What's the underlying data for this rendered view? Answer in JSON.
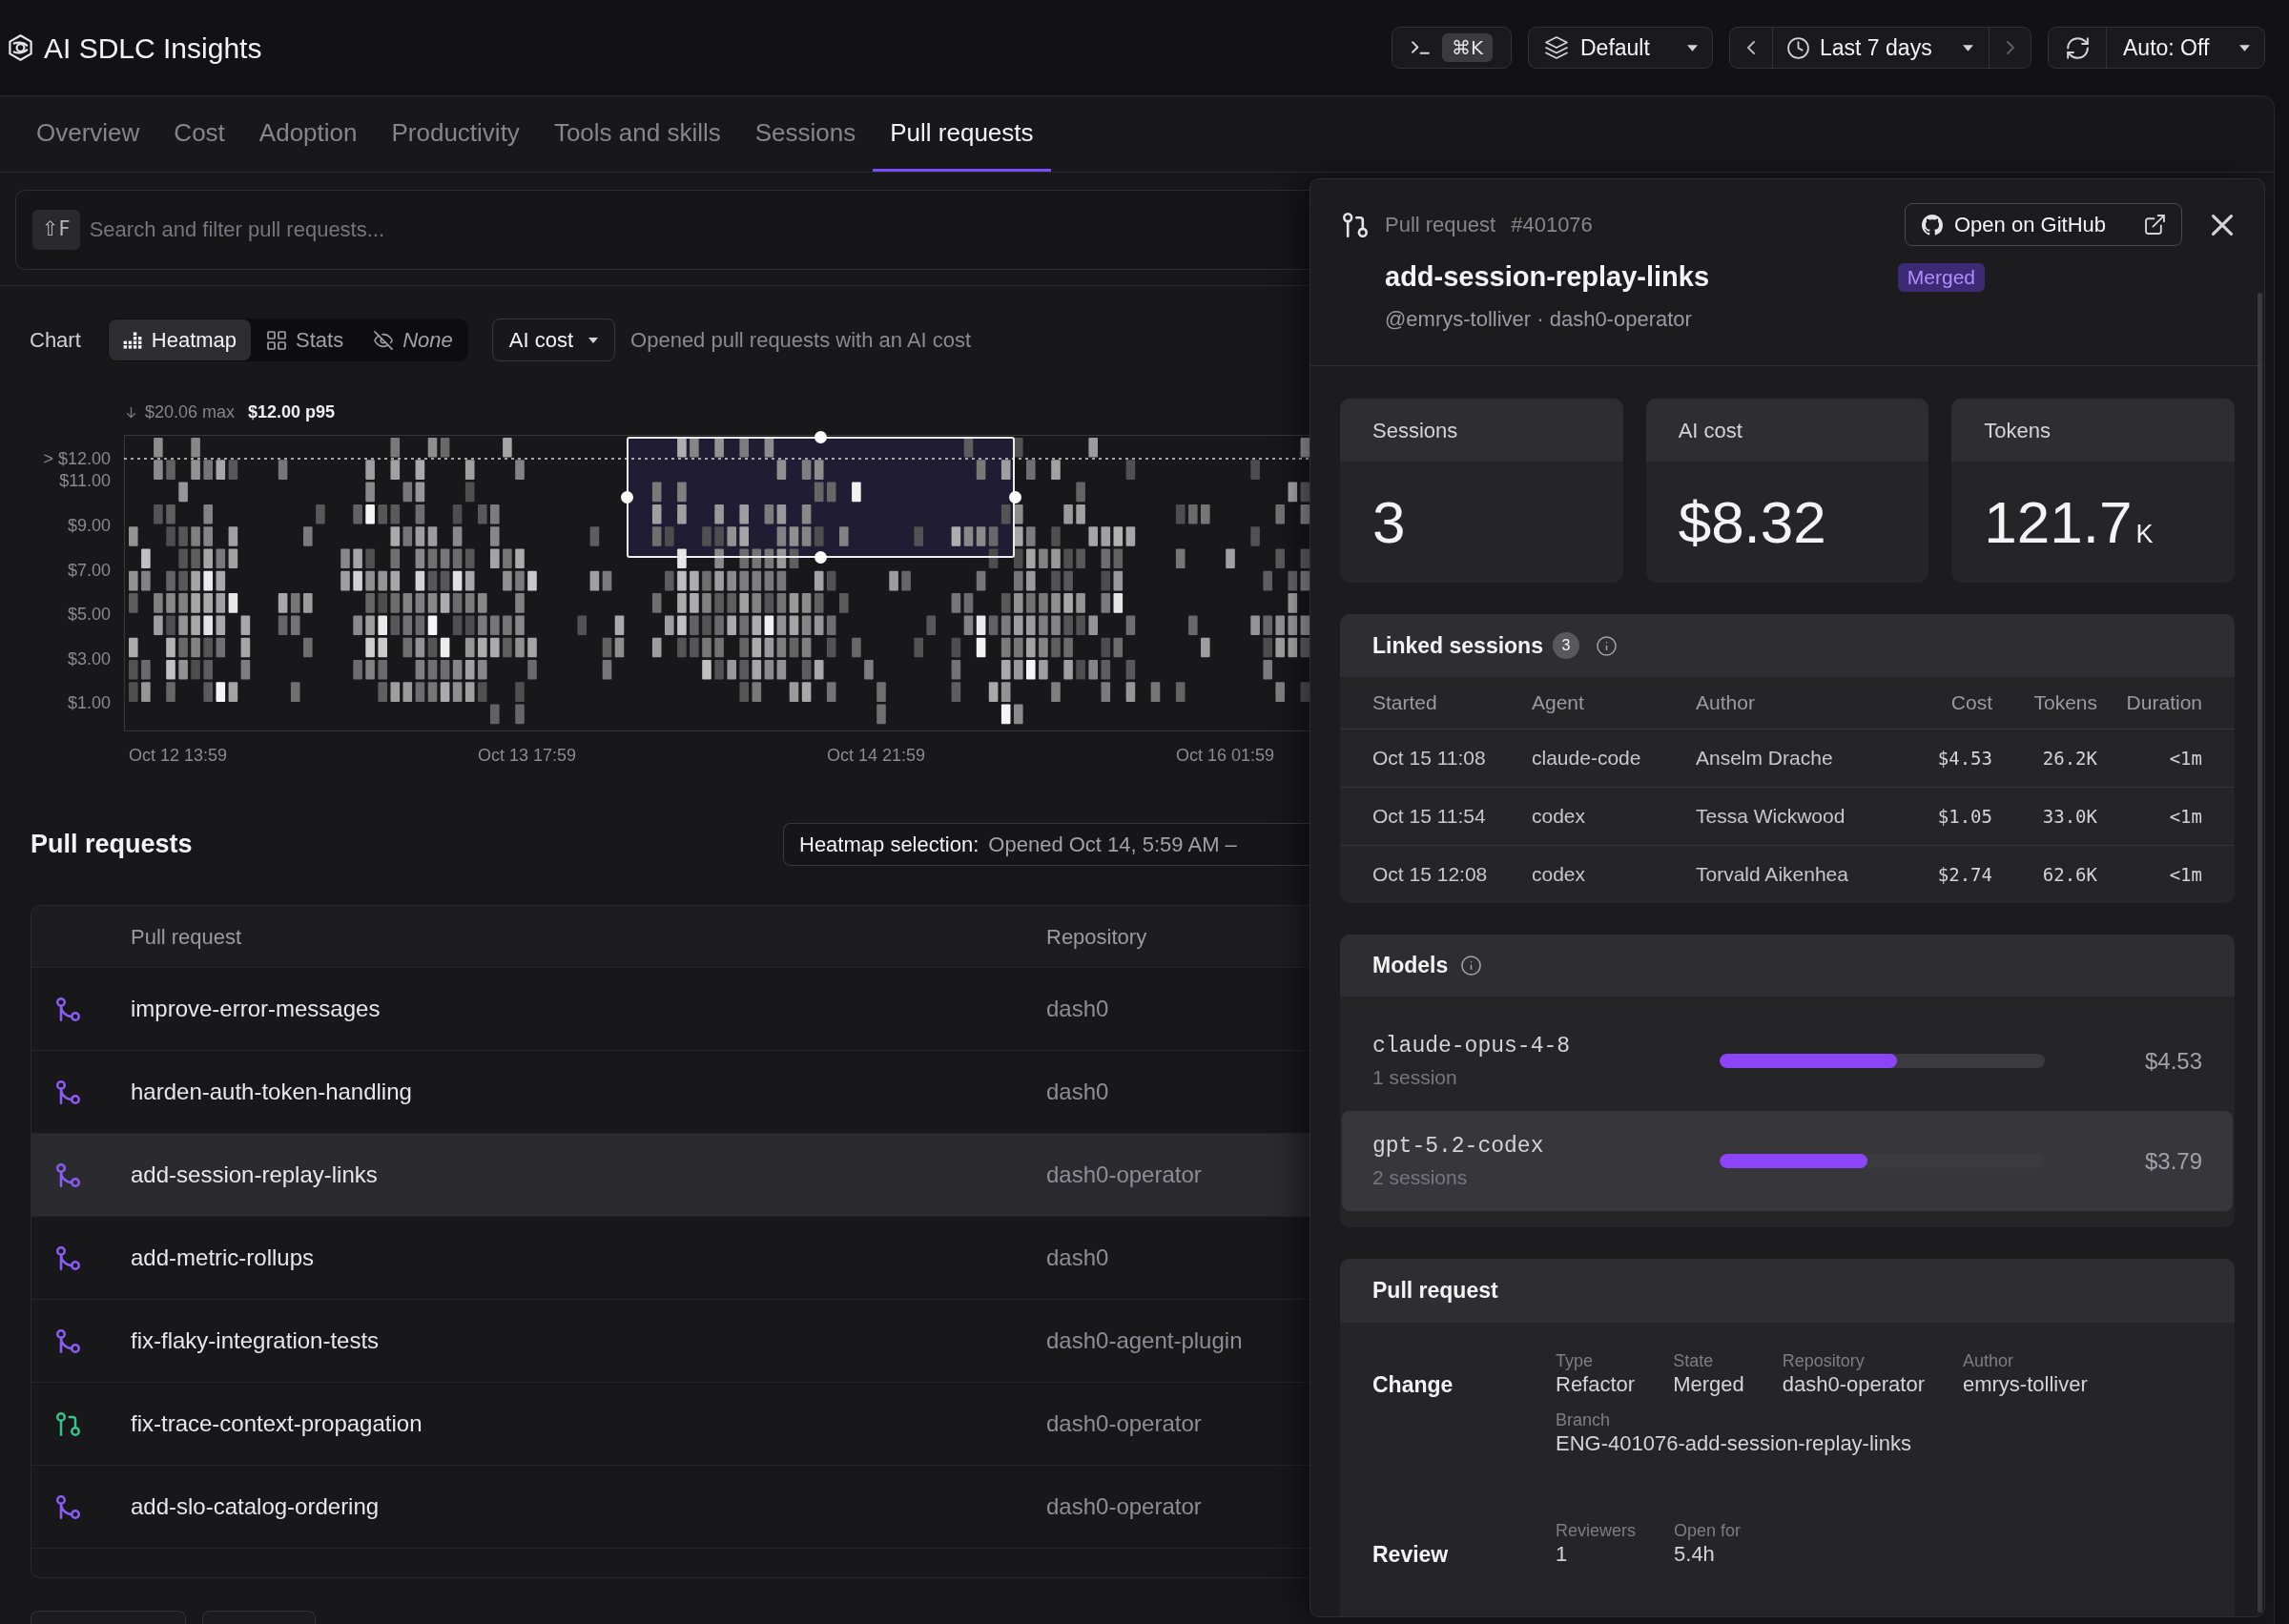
{
  "app": {
    "title": "AI SDLC Insights"
  },
  "toolbar": {
    "command_shortcut": "⌘K",
    "view": "Default",
    "time_range": {
      "label": "Last 7 days",
      "next_disabled": true
    },
    "auto_refresh": "Auto: Off"
  },
  "tabs": [
    {
      "label": "Overview",
      "selected": false
    },
    {
      "label": "Cost",
      "selected": false
    },
    {
      "label": "Adoption",
      "selected": false
    },
    {
      "label": "Productivity",
      "selected": false
    },
    {
      "label": "Tools and skills",
      "selected": false
    },
    {
      "label": "Sessions",
      "selected": false
    },
    {
      "label": "Pull requests",
      "selected": true
    }
  ],
  "search": {
    "shortcut": "⇧F",
    "placeholder": "Search and filter pull requests..."
  },
  "chart_controls": {
    "label": "Chart",
    "modes": [
      {
        "kind": "heatmap",
        "label": "Heatmap",
        "selected": true
      },
      {
        "kind": "stats",
        "label": "Stats",
        "selected": false
      },
      {
        "kind": "none",
        "label": "None",
        "selected": false
      }
    ],
    "metric": "AI cost",
    "description": "Opened pull requests with an AI cost"
  },
  "heatmap": {
    "max": "$20.06 max",
    "p95": "$12.00 p95",
    "y_labels": [
      "> $12.00",
      "$11.00",
      "$9.00",
      "$7.00",
      "$5.00",
      "$3.00",
      "$1.00"
    ],
    "x_labels": [
      "Oct 12 13:59",
      "Oct 13 17:59",
      "Oct 14 21:59",
      "Oct 16 01:59"
    ]
  },
  "pull_requests": {
    "title": "Pull requests",
    "selection_label": "Heatmap selection:",
    "selection_value": "Opened Oct 14, 5:59 AM –",
    "columns": [
      "Pull request",
      "Repository"
    ],
    "rows": [
      {
        "kind": "merged",
        "name": "improve-error-messages",
        "repository": "dash0",
        "selected": false
      },
      {
        "kind": "merged",
        "name": "harden-auth-token-handling",
        "repository": "dash0",
        "selected": false
      },
      {
        "kind": "merged",
        "name": "add-session-replay-links",
        "repository": "dash0-operator",
        "selected": true
      },
      {
        "kind": "merged",
        "name": "add-metric-rollups",
        "repository": "dash0",
        "selected": false
      },
      {
        "kind": "merged",
        "name": "fix-flaky-integration-tests",
        "repository": "dash0-agent-plugin",
        "selected": false
      },
      {
        "kind": "open",
        "name": "fix-trace-context-propagation",
        "repository": "dash0-operator",
        "selected": false
      },
      {
        "kind": "merged",
        "name": "add-slo-catalog-ordering",
        "repository": "dash0-operator",
        "selected": false
      }
    ]
  },
  "detail": {
    "label": "Pull request",
    "number": "#401076",
    "github_button": "Open on GitHub",
    "title": "add-session-replay-links",
    "status": "Merged",
    "subtitle": "@emrys-tolliver · dash0-operator",
    "stats": [
      {
        "label": "Sessions",
        "value": "3"
      },
      {
        "label": "AI cost",
        "value": "$8.32"
      },
      {
        "label": "Tokens",
        "value": "121.7",
        "unit": "K"
      }
    ],
    "linked_sessions": {
      "title": "Linked sessions",
      "count": "3",
      "columns": [
        "Started",
        "Agent",
        "Author",
        "Cost",
        "Tokens",
        "Duration"
      ],
      "rows": [
        [
          "Oct 15 11:08",
          "claude-code",
          "Anselm Drache",
          "$4.53",
          "26.2K",
          "<1m"
        ],
        [
          "Oct 15 11:54",
          "codex",
          "Tessa Wickwood",
          "$1.05",
          "33.0K",
          "<1m"
        ],
        [
          "Oct 15 12:08",
          "codex",
          "Torvald Aikenhea",
          "$2.74",
          "62.6K",
          "<1m"
        ]
      ]
    },
    "models": {
      "title": "Models",
      "rows": [
        {
          "name": "claude-opus-4-8",
          "sessions": "1 session",
          "level": 0.545,
          "cost": "$4.53",
          "highlighted": false
        },
        {
          "name": "gpt-5.2-codex",
          "sessions": "2 sessions",
          "level": 0.456,
          "cost": "$3.79",
          "highlighted": true
        }
      ]
    },
    "pull_request": {
      "title": "Pull request",
      "sections": [
        {
          "label": "Change",
          "fields": [
            {
              "label": "Type",
              "value": "Refactor"
            },
            {
              "label": "State",
              "value": "Merged"
            },
            {
              "label": "Repository",
              "value": "dash0-operator"
            },
            {
              "label": "Author",
              "value": "emrys-tolliver"
            },
            {
              "label": "Branch",
              "value": "ENG-401076-add-session-replay-links"
            }
          ]
        },
        {
          "label": "Review",
          "fields": [
            {
              "label": "Reviewers",
              "value": "1"
            },
            {
              "label": "Open for",
              "value": "5.4h"
            }
          ]
        }
      ]
    }
  }
}
